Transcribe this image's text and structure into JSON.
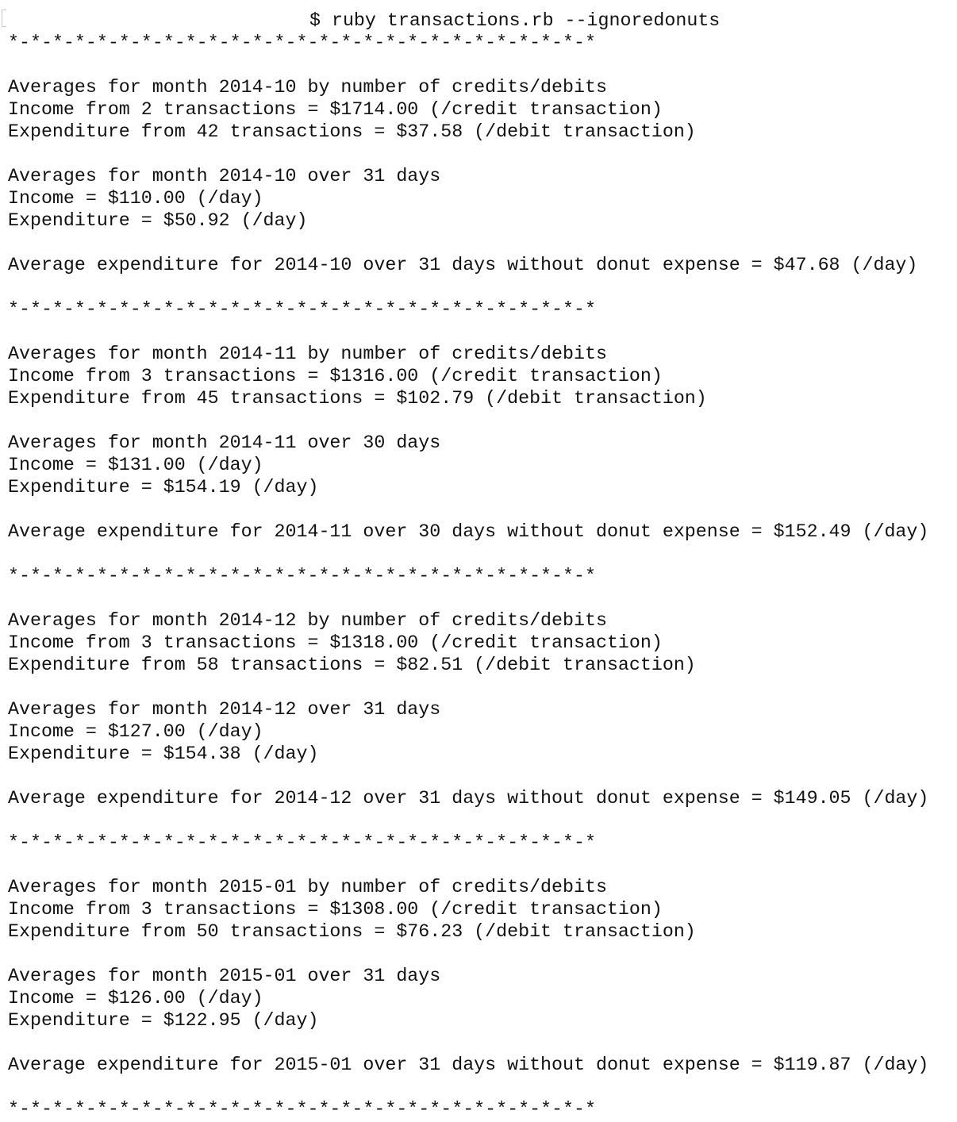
{
  "command": "$ ruby transactions.rb --ignoredonuts",
  "separator": "*-*-*-*-*-*-*-*-*-*-*-*-*-*-*-*-*-*-*-*-*-*-*-*-*-*-*",
  "months": [
    {
      "heading_count": "Averages for month 2014-10 by number of credits/debits",
      "income_count": "Income from 2 transactions = $1714.00 (/credit transaction)",
      "expenditure_count": "Expenditure from 42 transactions = $37.58 (/debit transaction)",
      "heading_days": "Averages for month 2014-10 over 31 days",
      "income_day": "Income = $110.00 (/day)",
      "expenditure_day": "Expenditure = $50.92 (/day)",
      "no_donut": "Average expenditure for 2014-10 over 31 days without donut expense = $47.68 (/day)"
    },
    {
      "heading_count": "Averages for month 2014-11 by number of credits/debits",
      "income_count": "Income from 3 transactions = $1316.00 (/credit transaction)",
      "expenditure_count": "Expenditure from 45 transactions = $102.79 (/debit transaction)",
      "heading_days": "Averages for month 2014-11 over 30 days",
      "income_day": "Income = $131.00 (/day)",
      "expenditure_day": "Expenditure = $154.19 (/day)",
      "no_donut": "Average expenditure for 2014-11 over 30 days without donut expense = $152.49 (/day)"
    },
    {
      "heading_count": "Averages for month 2014-12 by number of credits/debits",
      "income_count": "Income from 3 transactions = $1318.00 (/credit transaction)",
      "expenditure_count": "Expenditure from 58 transactions = $82.51 (/debit transaction)",
      "heading_days": "Averages for month 2014-12 over 31 days",
      "income_day": "Income = $127.00 (/day)",
      "expenditure_day": "Expenditure = $154.38 (/day)",
      "no_donut": "Average expenditure for 2014-12 over 31 days without donut expense = $149.05 (/day)"
    },
    {
      "heading_count": "Averages for month 2015-01 by number of credits/debits",
      "income_count": "Income from 3 transactions = $1308.00 (/credit transaction)",
      "expenditure_count": "Expenditure from 50 transactions = $76.23 (/debit transaction)",
      "heading_days": "Averages for month 2015-01 over 31 days",
      "income_day": "Income = $126.00 (/day)",
      "expenditure_day": "Expenditure = $122.95 (/day)",
      "no_donut": "Average expenditure for 2015-01 over 31 days without donut expense = $119.87 (/day)"
    }
  ]
}
